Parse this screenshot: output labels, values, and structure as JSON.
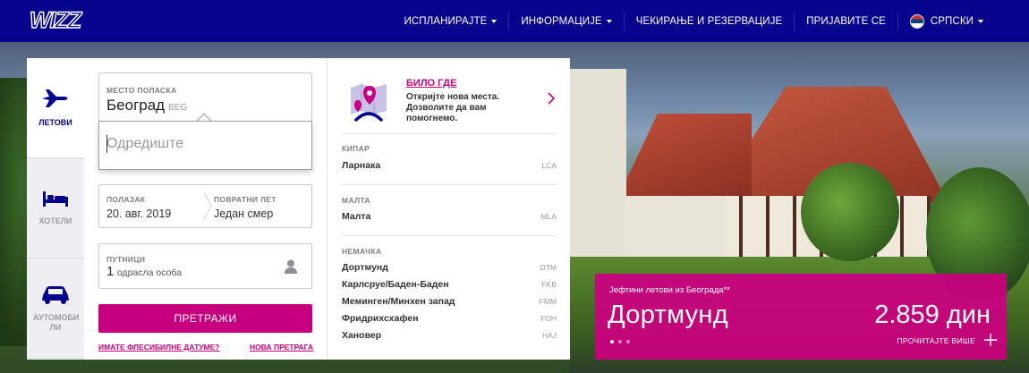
{
  "nav": {
    "items": [
      {
        "label": "ИСПЛАНИРАЈТЕ",
        "dropdown": true
      },
      {
        "label": "ИНФОРМАЦИЈЕ",
        "dropdown": true
      },
      {
        "label": "ЧЕКИРАЊЕ И РЕЗЕРВАЦИЈЕ",
        "dropdown": false
      },
      {
        "label": "ПРИЈАВИТЕ СЕ",
        "dropdown": false
      }
    ],
    "language": "СРПСКИ"
  },
  "colors": {
    "brand_navy": "#06038d",
    "brand_magenta": "#c6007e"
  },
  "tabs": [
    {
      "label": "ЛЕТОВИ",
      "icon": "plane-icon",
      "active": true
    },
    {
      "label": "ХОТЕЛИ",
      "icon": "bed-icon",
      "active": false
    },
    {
      "label": "АУТОМОБИ ЛИ",
      "icon": "car-icon",
      "active": false
    }
  ],
  "search": {
    "departure_label": "МЕСТО ПОЛАСКА",
    "departure_value": "Београд",
    "departure_code": "BEG",
    "destination_placeholder": "Одредиште",
    "outbound_label": "ПОЛАЗАК",
    "outbound_value": "20. авг. 2019",
    "return_label": "ПОВРАТНИ ЛЕТ",
    "return_value": "Један смер",
    "passengers_label": "ПУТНИЦИ",
    "passengers_count": "1",
    "passengers_text": "одрасла особа",
    "search_button": "ПРЕТРАЖИ",
    "flexible_link": "ИМАТЕ ФЛЕСИБИЛНЕ ДАТУМЕ?",
    "new_search_link": "НОВА ПРЕТРАГА"
  },
  "dropdown": {
    "anywhere_title": "БИЛО ГДЕ",
    "anywhere_text": "Откријте нова места. Дозволите да вам помогнемо.",
    "groups": [
      {
        "country": "КИПАР",
        "cities": [
          {
            "name": "Ларнака",
            "code": "LCA"
          }
        ]
      },
      {
        "country": "МАЛТА",
        "cities": [
          {
            "name": "Малта",
            "code": "MLA"
          }
        ]
      },
      {
        "country": "НЕМАЧКА",
        "cities": [
          {
            "name": "Дортмунд",
            "code": "DTM"
          },
          {
            "name": "Карлсруе/Баден-Баден",
            "code": "FKB"
          },
          {
            "name": "Меминген/Минхен запад",
            "code": "FMM"
          },
          {
            "name": "Фридрихсхафен",
            "code": "FDH"
          },
          {
            "name": "Хановер",
            "code": "HAJ"
          }
        ]
      }
    ]
  },
  "promo": {
    "label": "Јефтини летови из Београда**",
    "city": "Дортмунд",
    "price": "2.859 дин",
    "more": "ПРОЧИТАЈТЕ ВИШЕ"
  }
}
